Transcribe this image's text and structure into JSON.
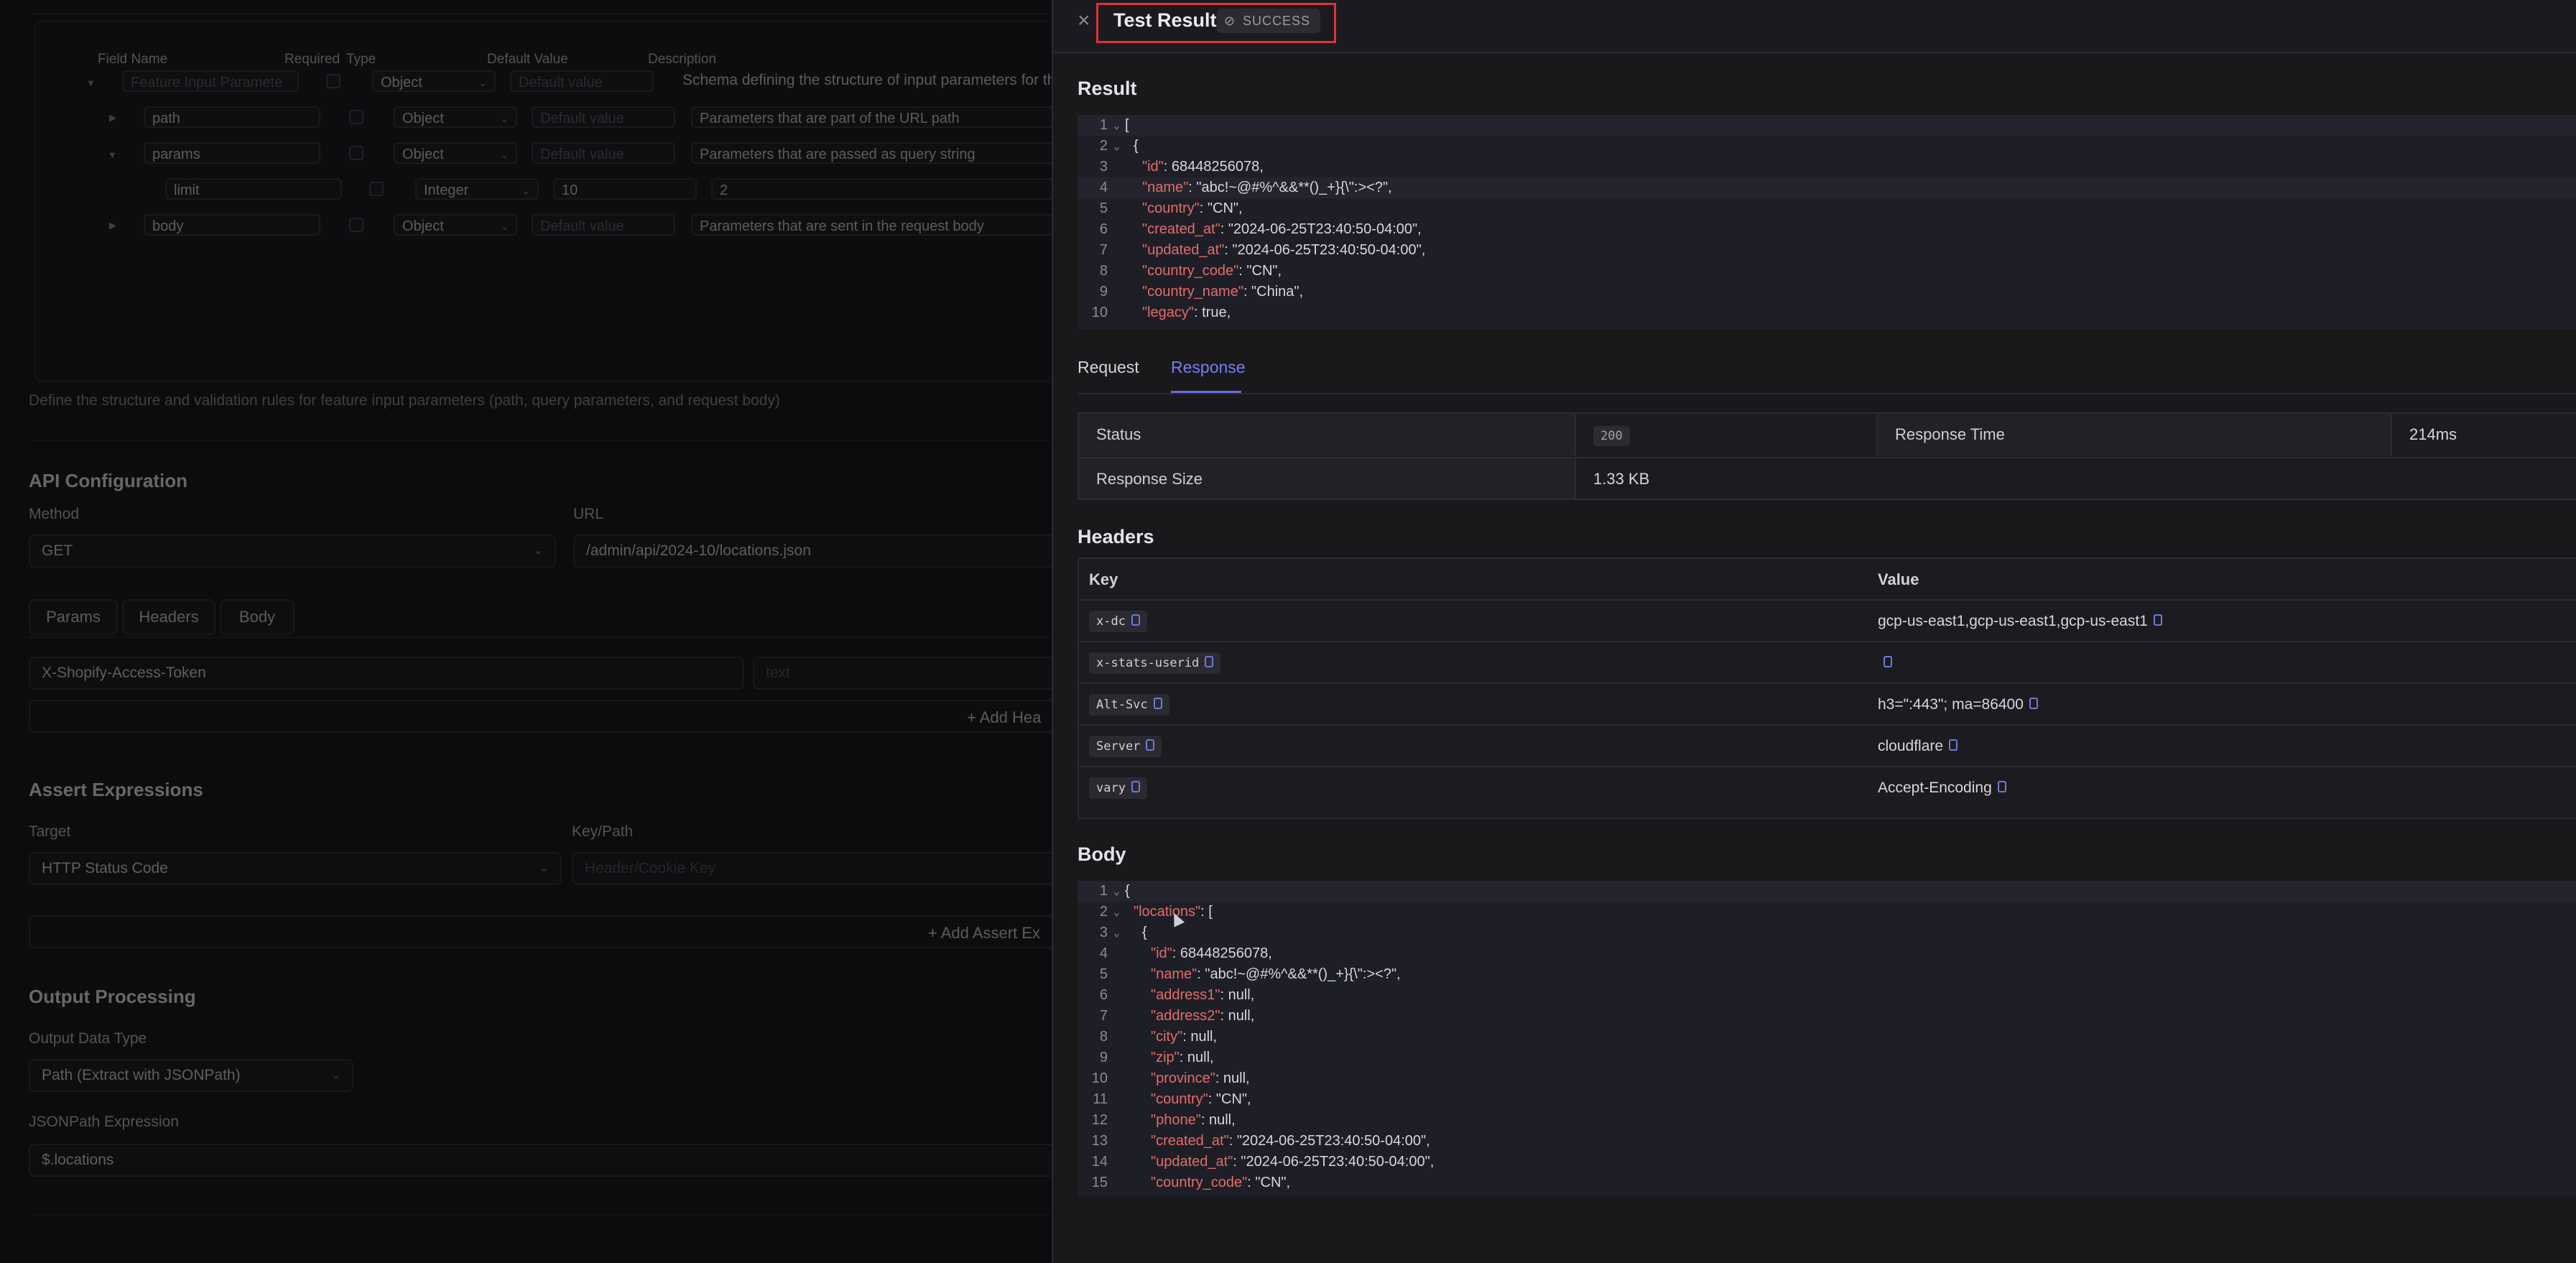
{
  "background": {
    "schema_table": {
      "headers": [
        "Field Name",
        "Required",
        "Type",
        "Default Value",
        "Description"
      ],
      "rows": [
        {
          "name": "Feature Input Paramete",
          "type": "Object",
          "default": "Default value",
          "description": "Schema defining the structure of input parameters for thi"
        },
        {
          "name": "path",
          "type": "Object",
          "default": "Default value",
          "description": "Parameters that are part of the URL path"
        },
        {
          "name": "params",
          "type": "Object",
          "default": "Default value",
          "description": "Parameters that are passed as query string"
        },
        {
          "name": "limit",
          "type": "Integer",
          "default": "10",
          "description": "2"
        },
        {
          "name": "body",
          "type": "Object",
          "default": "Default value",
          "description": "Parameters that are sent in the request body"
        }
      ],
      "help": "Define the structure and validation rules for feature input parameters (path, query parameters, and request body)"
    },
    "api_config": {
      "title": "API Configuration",
      "method_label": "Method",
      "method_value": "GET",
      "url_label": "URL",
      "url_value": "/admin/api/2024-10/locations.json",
      "tabs": [
        "Params",
        "Headers",
        "Body"
      ],
      "header_key": "X-Shopify-Access-Token",
      "header_value_placeholder": "text",
      "add_header": "Add Hea"
    },
    "assert": {
      "title": "Assert Expressions",
      "target_label": "Target",
      "target_value": "HTTP Status Code",
      "keypath_label": "Key/Path",
      "keypath_placeholder": "Header/Cookie Key",
      "add_assert": "Add Assert Ex"
    },
    "output": {
      "title": "Output Processing",
      "type_label": "Output Data Type",
      "type_value": "Path (Extract with JSONPath)",
      "expr_label": "JSONPath Expression",
      "expr_value": "$.locations"
    }
  },
  "drawer": {
    "title": "Test Result",
    "status_badge": "SUCCESS",
    "result_heading": "Result",
    "result_lines": [
      {
        "n": "1",
        "fold": true,
        "indent": 0,
        "key": "",
        "val": "["
      },
      {
        "n": "2",
        "fold": true,
        "indent": 1,
        "key": "",
        "val": "{"
      },
      {
        "n": "3",
        "fold": false,
        "indent": 2,
        "key": "\"id\"",
        "val": ": 68448256078,"
      },
      {
        "n": "4",
        "fold": false,
        "indent": 2,
        "key": "\"name\"",
        "val": ": \"abc!~@#%^&&**()_+}{\\\":><?\","
      },
      {
        "n": "5",
        "fold": false,
        "indent": 2,
        "key": "\"country\"",
        "val": ": \"CN\","
      },
      {
        "n": "6",
        "fold": false,
        "indent": 2,
        "key": "\"created_at\"",
        "val": ": \"2024-06-25T23:40:50-04:00\","
      },
      {
        "n": "7",
        "fold": false,
        "indent": 2,
        "key": "\"updated_at\"",
        "val": ": \"2024-06-25T23:40:50-04:00\","
      },
      {
        "n": "8",
        "fold": false,
        "indent": 2,
        "key": "\"country_code\"",
        "val": ": \"CN\","
      },
      {
        "n": "9",
        "fold": false,
        "indent": 2,
        "key": "\"country_name\"",
        "val": ": \"China\","
      },
      {
        "n": "10",
        "fold": false,
        "indent": 2,
        "key": "\"legacy\"",
        "val": ": true,"
      }
    ],
    "tabs": [
      "Request",
      "Response"
    ],
    "active_tab": "Response",
    "stats": {
      "status_label": "Status",
      "status_value": "200",
      "time_label": "Response Time",
      "time_value": "214ms",
      "size_label": "Response Size",
      "size_value": "1.33 KB"
    },
    "headers_heading": "Headers",
    "headers_columns": [
      "Key",
      "Value"
    ],
    "headers": [
      {
        "key": "x-dc",
        "value": "gcp-us-east1,gcp-us-east1,gcp-us-east1"
      },
      {
        "key": "x-stats-userid",
        "value": ""
      },
      {
        "key": "Alt-Svc",
        "value": "h3=\":443\"; ma=86400"
      },
      {
        "key": "Server",
        "value": "cloudflare"
      },
      {
        "key": "vary",
        "value": "Accept-Encoding"
      }
    ],
    "body_heading": "Body",
    "body_lines": [
      {
        "n": "1",
        "fold": true,
        "indent": 0,
        "key": "",
        "val": "{"
      },
      {
        "n": "2",
        "fold": true,
        "indent": 1,
        "key": "\"locations\"",
        "val": ": ["
      },
      {
        "n": "3",
        "fold": true,
        "indent": 2,
        "key": "",
        "val": "{"
      },
      {
        "n": "4",
        "fold": false,
        "indent": 3,
        "key": "\"id\"",
        "val": ": 68448256078,"
      },
      {
        "n": "5",
        "fold": false,
        "indent": 3,
        "key": "\"name\"",
        "val": ": \"abc!~@#%^&&**()_+}{\\\":><?\","
      },
      {
        "n": "6",
        "fold": false,
        "indent": 3,
        "key": "\"address1\"",
        "val": ": null,"
      },
      {
        "n": "7",
        "fold": false,
        "indent": 3,
        "key": "\"address2\"",
        "val": ": null,"
      },
      {
        "n": "8",
        "fold": false,
        "indent": 3,
        "key": "\"city\"",
        "val": ": null,"
      },
      {
        "n": "9",
        "fold": false,
        "indent": 3,
        "key": "\"zip\"",
        "val": ": null,"
      },
      {
        "n": "10",
        "fold": false,
        "indent": 3,
        "key": "\"province\"",
        "val": ": null,"
      },
      {
        "n": "11",
        "fold": false,
        "indent": 3,
        "key": "\"country\"",
        "val": ": \"CN\","
      },
      {
        "n": "12",
        "fold": false,
        "indent": 3,
        "key": "\"phone\"",
        "val": ": null,"
      },
      {
        "n": "13",
        "fold": false,
        "indent": 3,
        "key": "\"created_at\"",
        "val": ": \"2024-06-25T23:40:50-04:00\","
      },
      {
        "n": "14",
        "fold": false,
        "indent": 3,
        "key": "\"updated_at\"",
        "val": ": \"2024-06-25T23:40:50-04:00\","
      },
      {
        "n": "15",
        "fold": false,
        "indent": 3,
        "key": "\"country_code\"",
        "val": ": \"CN\","
      }
    ],
    "colors": {
      "accent": "#7c7cf0",
      "json_key": "#e46b6b",
      "highlight_box": "#e0323a"
    }
  }
}
